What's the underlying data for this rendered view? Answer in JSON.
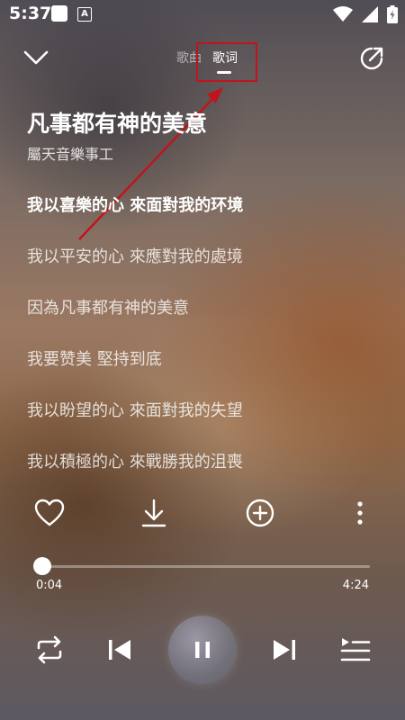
{
  "status_bar": {
    "time": "5:37",
    "notification_letter": "A"
  },
  "header": {
    "tabs": [
      {
        "label": "歌曲",
        "active": false
      },
      {
        "label": "歌词",
        "active": true
      }
    ]
  },
  "song": {
    "title": "凡事都有神的美意",
    "artist": "屬天音樂事工"
  },
  "lyrics": {
    "lines": [
      "我以喜樂的心 來面對我的环境",
      "我以平安的心 來應對我的處境",
      "因為凡事都有神的美意",
      "我要赞美 堅持到底",
      "我以盼望的心 來面對我的失望",
      "我以積極的心 來戰勝我的沮喪"
    ],
    "current_index": 0
  },
  "actions": [
    "heart-icon",
    "download-icon",
    "add-icon",
    "more-icon"
  ],
  "player": {
    "current_time": "0:04",
    "total_time": "4:24",
    "progress": 0.015,
    "state": "playing"
  },
  "colors": {
    "annotation_red": "#c0151c",
    "text": "#ffffff"
  }
}
